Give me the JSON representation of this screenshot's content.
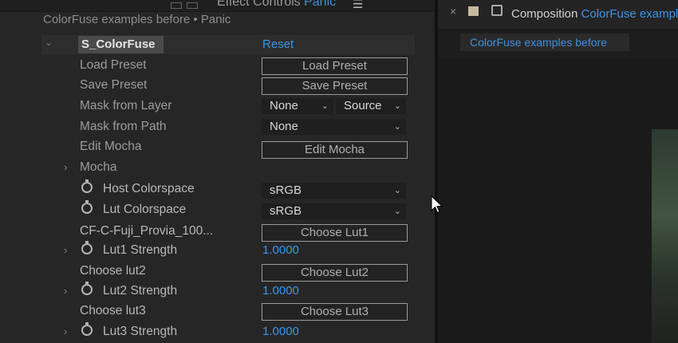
{
  "effect_controls": {
    "tab_title": "Effect Controls",
    "tab_layer": "Panic",
    "layer_title": "ColorFuse examples before • Panic",
    "effect_name": "S_ColorFuse",
    "reset_label": "Reset",
    "rows": {
      "load_preset": {
        "label": "Load Preset",
        "button": "Load Preset"
      },
      "save_preset": {
        "label": "Save Preset",
        "button": "Save Preset"
      },
      "mask_from_layer": {
        "label": "Mask from Layer",
        "value": "None",
        "source": "Source"
      },
      "mask_from_path": {
        "label": "Mask from Path",
        "value": "None"
      },
      "edit_mocha": {
        "label": "Edit Mocha",
        "button": "Edit Mocha"
      },
      "mocha": {
        "label": "Mocha"
      },
      "host_colorspace": {
        "label": "Host Colorspace",
        "value": "sRGB"
      },
      "lut_colorspace": {
        "label": "Lut Colorspace",
        "value": "sRGB"
      },
      "lut1": {
        "label": "CF-C-Fuji_Provia_100...",
        "button": "Choose Lut1"
      },
      "lut1_strength": {
        "label": "Lut1 Strength",
        "value": "1.0000"
      },
      "lut2": {
        "label": "Choose lut2",
        "button": "Choose Lut2"
      },
      "lut2_strength": {
        "label": "Lut2 Strength",
        "value": "1.0000"
      },
      "lut3": {
        "label": "Choose lut3",
        "button": "Choose Lut3"
      },
      "lut3_strength": {
        "label": "Lut3 Strength",
        "value": "1.0000"
      }
    }
  },
  "composition": {
    "label": "Composition",
    "name": "ColorFuse examples",
    "tab": "ColorFuse examples before"
  },
  "colors": {
    "accent": "#3f94ea",
    "panel_bg": "#262626"
  },
  "icons": [
    "menu-icon",
    "close-icon",
    "lock-icon",
    "stopwatch-icon",
    "chevron-down-icon",
    "twirl-arrow-icon",
    "cursor-icon"
  ]
}
